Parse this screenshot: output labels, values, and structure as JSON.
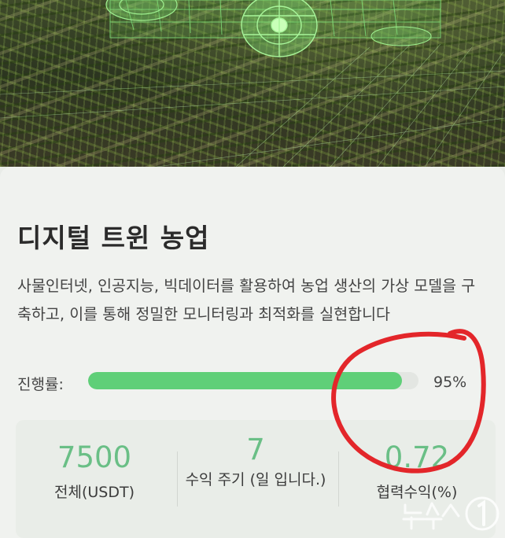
{
  "project": {
    "title": "디지털 트윈 농업",
    "description": "사물인터넷, 인공지능, 빅데이터를 활용하여 농업 생산의 가상 모델을 구축하고, 이를 통해 정밀한 모니터링과 최적화를 실현합니다"
  },
  "progress": {
    "label": "진행률:",
    "value_text": "95%",
    "fraction": 0.95
  },
  "stats": [
    {
      "value": "7500",
      "label": "전체(USDT)"
    },
    {
      "value": "7",
      "label": "수익 주기 (일 입니다.)"
    },
    {
      "value": "0.72",
      "label": "협력수익(%)"
    }
  ],
  "colors": {
    "accent_green": "#5fcf78",
    "stat_green": "#6abf86",
    "annotation_red": "#e3262a"
  },
  "watermark": "뉴스1"
}
